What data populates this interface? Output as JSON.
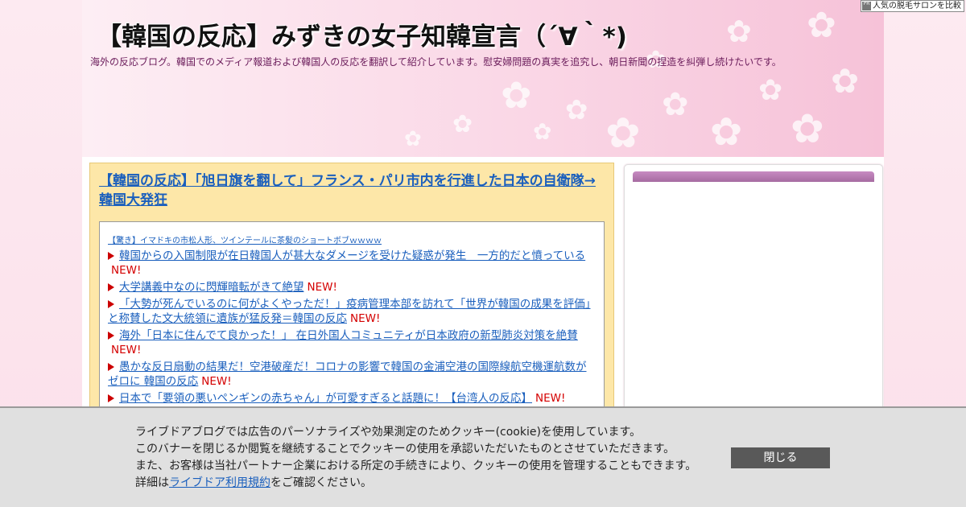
{
  "header": {
    "title": "【韓国の反応】みずきの女子知韓宣言（´∀｀*)",
    "description": "海外の反応ブログ。韓国でのメディア報道および韓国人の反応を翻訳して紹介しています。慰安婦問題の真実を追究し、朝日新聞の捏造を糾弾し続けたいです。"
  },
  "ad_badge": {
    "mark": "PR",
    "label": "人気の脱毛サロンを比較"
  },
  "article": {
    "title": "【韓国の反応】「旭日旗を翻して」フランス・パリ市内を行進した日本の自衛隊→韓国大発狂"
  },
  "related": {
    "top_link": "【驚き】イマドキの市松人形、ツインテールに茶髪のショートボブｗｗｗｗ",
    "new_label": "NEW!",
    "items": [
      {
        "text": "韓国からの入国制限が在日韓国人が甚大なダメージを受けた疑惑が発生　一方的だと憤っている"
      },
      {
        "text": "大学講義中なのに閃輝暗転がきて絶望"
      },
      {
        "text": "「大勢が死んでいるのに何がよくやっただ！」疫病管理本部を訪れて「世界が韓国の成果を評価」と称賛した文大統領に遺族が猛反発＝韓国の反応"
      },
      {
        "text": "海外「日本に住んでて良かった！」 在日外国人コミュニティが日本政府の新型肺炎対策を絶賛"
      },
      {
        "text": "愚かな反日扇動の結果だ！空港破産だ！コロナの影響で韓国の金浦空港の国際線航空機運航数がゼロに 韓国の反応"
      },
      {
        "text": "日本で「要領の悪いペンギンの赤ちゃん」が可愛すぎると話題に！【台湾人の反応】"
      }
    ]
  },
  "cookie": {
    "line1": "ライブドアブログでは広告のパーソナライズや効果測定のためクッキー(cookie)を使用しています。",
    "line2": "このバナーを閉じるか閲覧を継続することでクッキーの使用を承認いただいたものとさせていただきます。",
    "line3": "また、お客様は当社パートナー企業における所定の手続きにより、クッキーの使用を管理することもできます。",
    "line4_prefix": "詳細は",
    "line4_link": "ライブドア利用規約",
    "line4_suffix": "をご確認ください。",
    "close_label": "閉じる"
  },
  "colors": {
    "link": "#1a5fbd",
    "new_badge": "#d40000",
    "article_bg": "#fde7a8",
    "sidebar_head": "#b77ab2",
    "close_button": "#595959"
  }
}
